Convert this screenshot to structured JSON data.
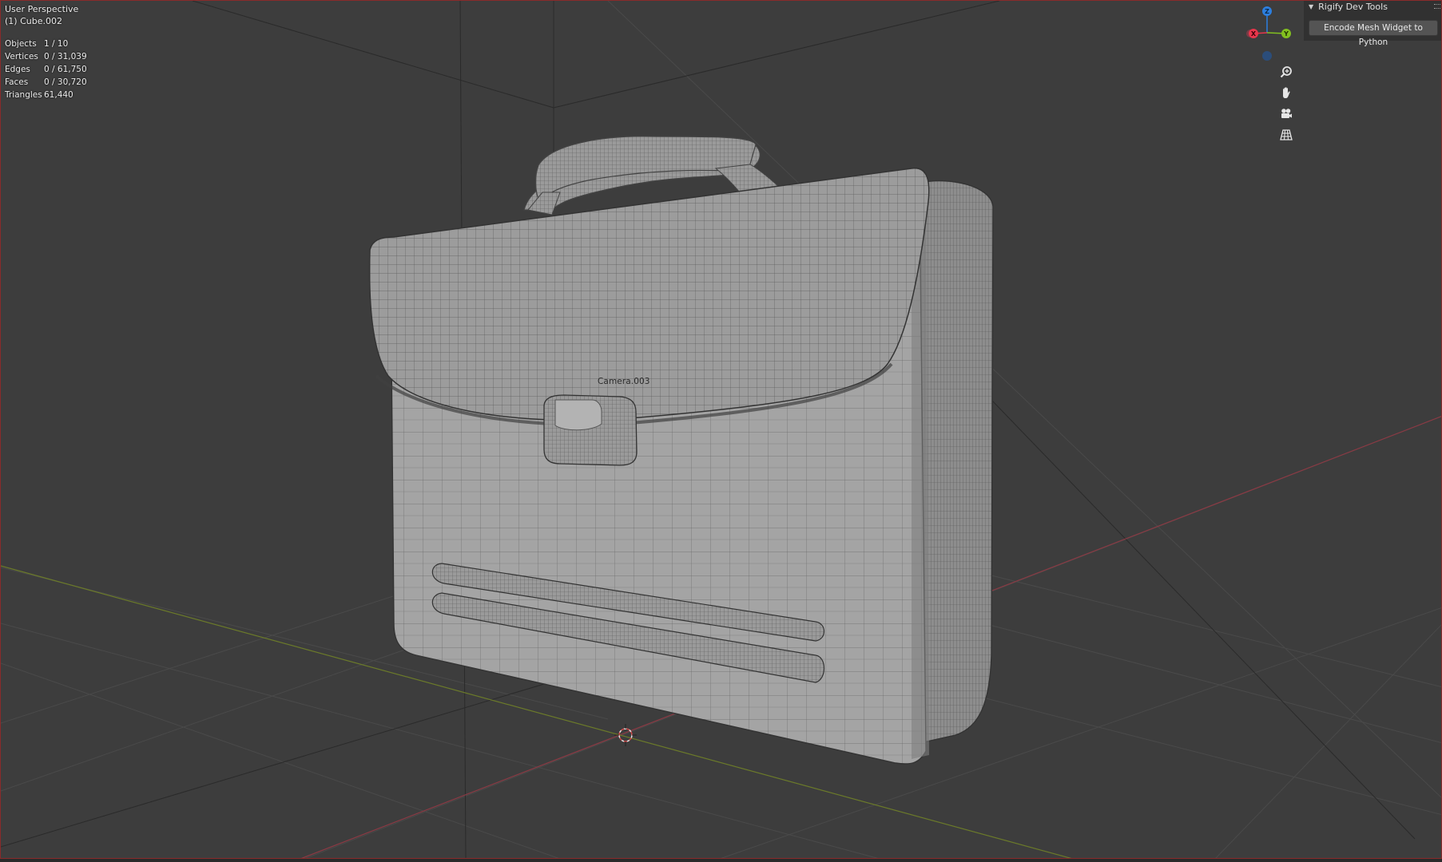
{
  "header": {
    "view_name": "User Perspective",
    "active_object": "(1) Cube.002"
  },
  "stats": [
    {
      "label": "Objects",
      "value": "1 / 10"
    },
    {
      "label": "Vertices",
      "value": "0 / 31,039"
    },
    {
      "label": "Edges",
      "value": "0 / 61,750"
    },
    {
      "label": "Faces",
      "value": "0 / 30,720"
    },
    {
      "label": "Triangles",
      "value": "61,440"
    }
  ],
  "gizmo": {
    "x_label": "X",
    "y_label": "Y",
    "z_label": "Z",
    "x_color": "#e8364c",
    "y_color": "#82c020",
    "z_color": "#2c7fe0"
  },
  "nav_buttons": [
    {
      "icon": "zoom-icon"
    },
    {
      "icon": "hand-pan-icon"
    },
    {
      "icon": "camera-view-icon"
    },
    {
      "icon": "perspective-grid-icon"
    }
  ],
  "sidebar_panel": {
    "title": "Rigify Dev Tools",
    "button_label": "Encode Mesh Widget to Python"
  },
  "scene": {
    "camera_label": "Camera.003",
    "background_color": "#3d3d3d"
  }
}
